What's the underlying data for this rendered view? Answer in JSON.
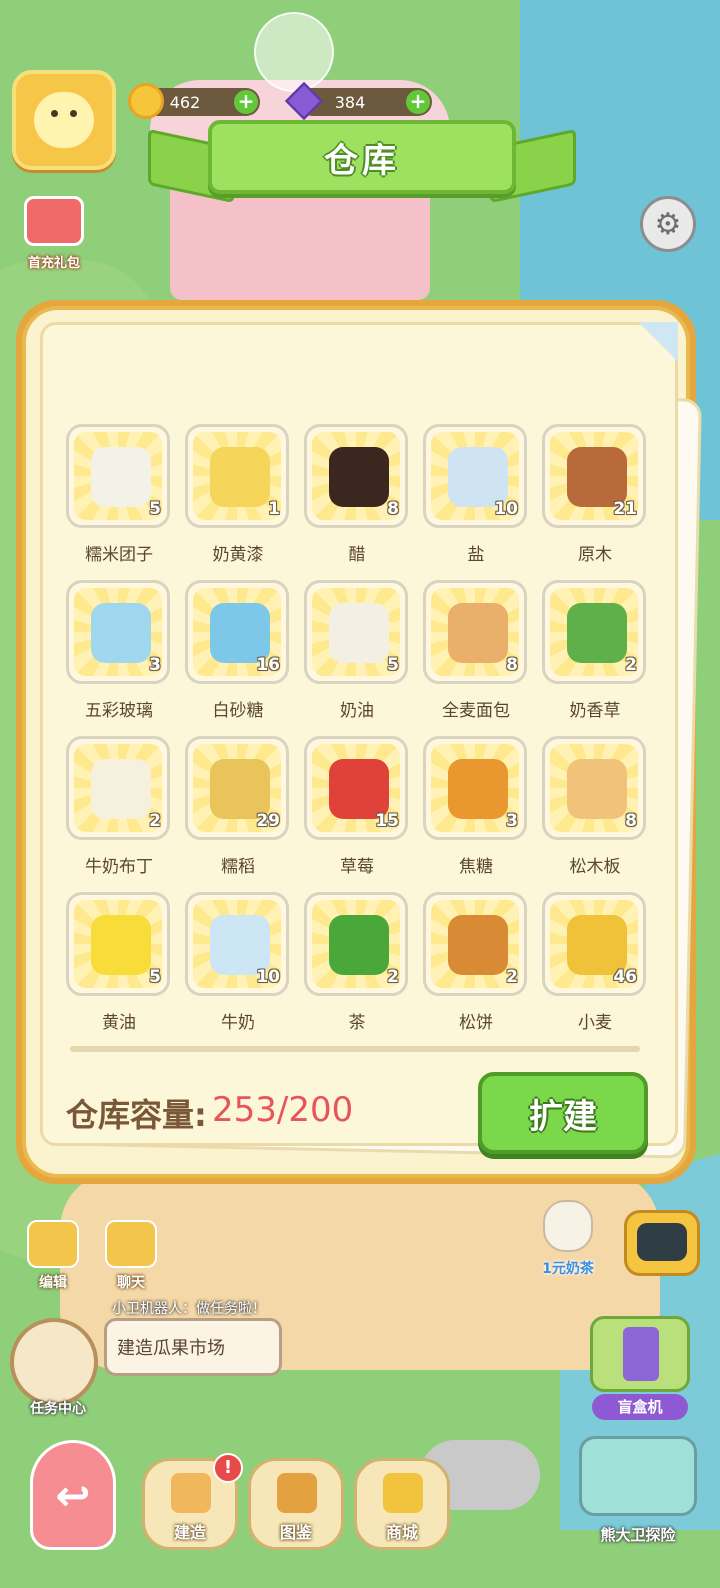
{
  "hud": {
    "coins": "462",
    "gems": "384"
  },
  "title": "仓库",
  "side": {
    "gift_label": "首充礼包"
  },
  "items": [
    {
      "name": "糯米团子",
      "count": "5",
      "color": "#f2f2e8"
    },
    {
      "name": "奶黄漆",
      "count": "1",
      "color": "#f6d65a"
    },
    {
      "name": "醋",
      "count": "8",
      "color": "#3b2720"
    },
    {
      "name": "盐",
      "count": "10",
      "color": "#cfe4f3"
    },
    {
      "name": "原木",
      "count": "21",
      "color": "#b86a3a"
    },
    {
      "name": "五彩玻璃",
      "count": "3",
      "color": "#9fd7ee"
    },
    {
      "name": "白砂糖",
      "count": "16",
      "color": "#7dc8e8"
    },
    {
      "name": "奶油",
      "count": "5",
      "color": "#f3efe5"
    },
    {
      "name": "全麦面包",
      "count": "8",
      "color": "#e8b06a"
    },
    {
      "name": "奶香草",
      "count": "2",
      "color": "#5fb04a"
    },
    {
      "name": "牛奶布丁",
      "count": "2",
      "color": "#f6f0de"
    },
    {
      "name": "糯稻",
      "count": "29",
      "color": "#e8c45a"
    },
    {
      "name": "草莓",
      "count": "15",
      "color": "#e0423a"
    },
    {
      "name": "焦糖",
      "count": "3",
      "color": "#e8982e"
    },
    {
      "name": "松木板",
      "count": "8",
      "color": "#f0c27a"
    },
    {
      "name": "黄油",
      "count": "5",
      "color": "#f8dc3a"
    },
    {
      "name": "牛奶",
      "count": "10",
      "color": "#cde6f6"
    },
    {
      "name": "茶",
      "count": "2",
      "color": "#4aa83a"
    },
    {
      "name": "松饼",
      "count": "2",
      "color": "#d98a34"
    },
    {
      "name": "小麦",
      "count": "46",
      "color": "#f0c23a"
    }
  ],
  "capacity": {
    "label": "仓库容量:",
    "value": "253/200"
  },
  "expand_label": "扩建",
  "bottom": {
    "edit_label": "编辑",
    "chat_label": "聊天",
    "robot_title": "小卫机器人：做任务啦！",
    "task_text": "建造瓜果市场",
    "task_center_label": "任务中心",
    "tea_label": "1元奶茶",
    "blind_box_label": "盲盒机",
    "back_icon": "↩",
    "nav": {
      "build": "建造",
      "album": "图鉴",
      "shop": "商城"
    },
    "alert_mark": "!",
    "explore_label": "熊大卫探险"
  }
}
